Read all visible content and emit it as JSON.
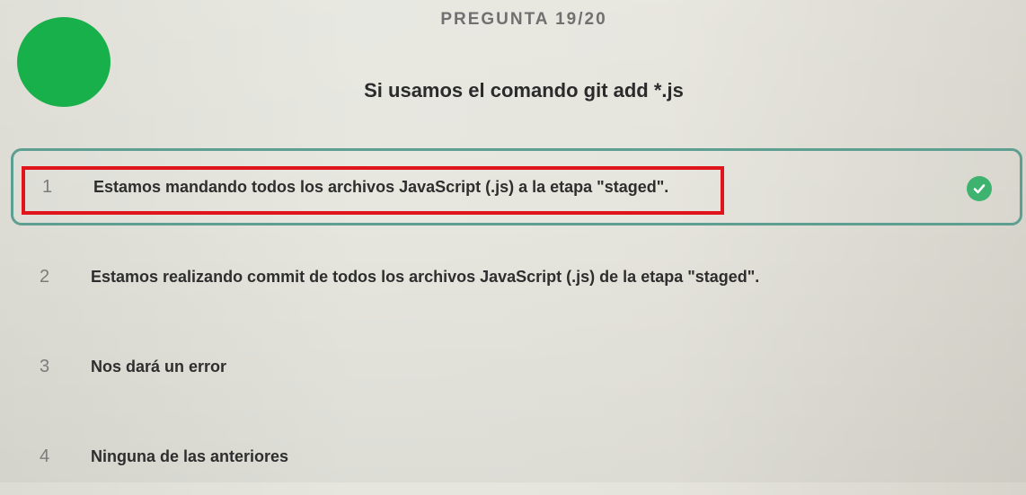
{
  "colors": {
    "avatar": "#18b04a",
    "selected_border": "#5f9f92",
    "correct_check": "#3eb26f",
    "highlight": "#e0141b"
  },
  "header": {
    "counter": "PREGUNTA 19/20",
    "avatar_icon": "green-circle-avatar"
  },
  "question": {
    "title": "Si usamos el comando git add *.js"
  },
  "options": [
    {
      "number": "1",
      "text": "Estamos mandando todos los archivos JavaScript (.js) a la etapa \"staged\".",
      "selected": true,
      "status_icon": "check-circle-icon"
    },
    {
      "number": "2",
      "text": "Estamos realizando commit de todos los archivos JavaScript (.js) de la etapa \"staged\".",
      "selected": false
    },
    {
      "number": "3",
      "text": "Nos dará un error",
      "selected": false
    },
    {
      "number": "4",
      "text": "Ninguna de las anteriores",
      "selected": false
    }
  ],
  "annotation": {
    "target_option": "1",
    "icon": "red-highlight-box"
  }
}
